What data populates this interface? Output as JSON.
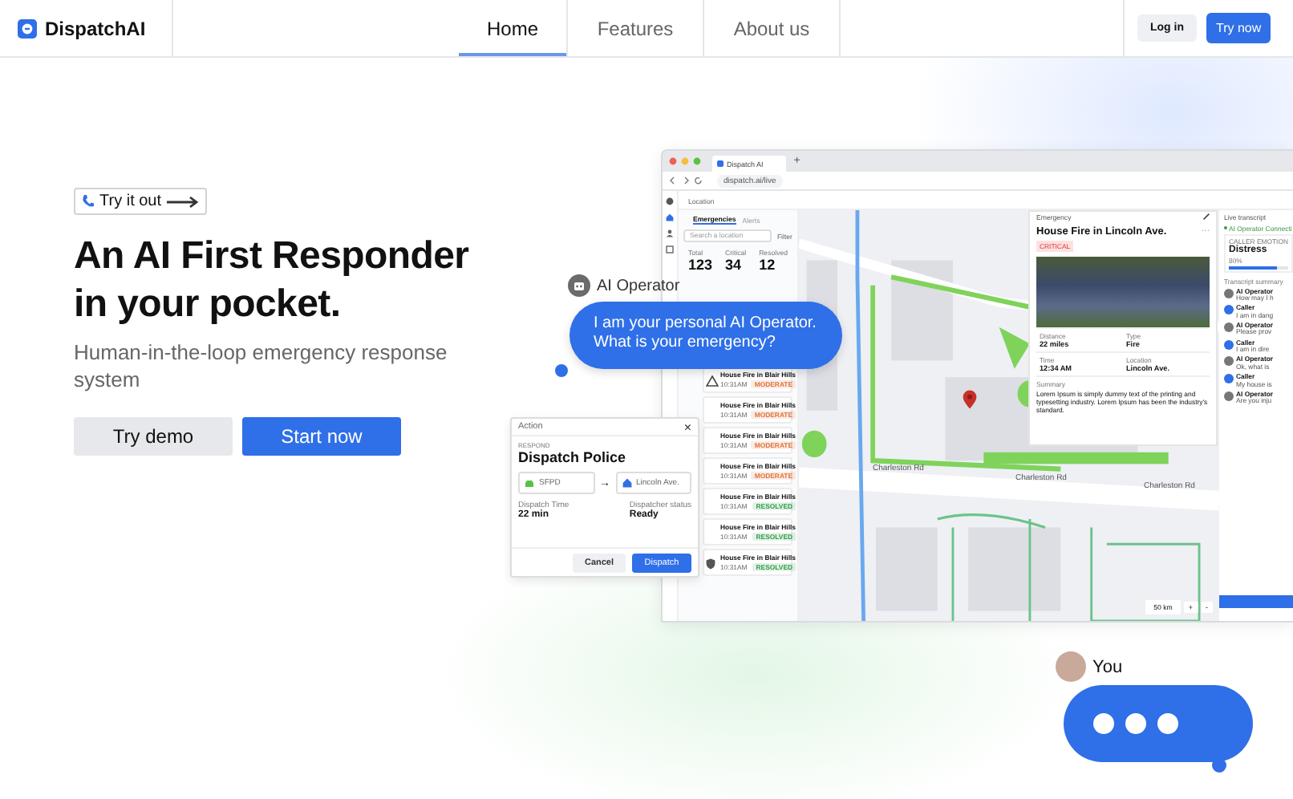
{
  "nav": {
    "logo": "DispatchAI",
    "links": [
      {
        "label": "Home",
        "selected": true
      },
      {
        "label": "Features",
        "selected": false
      },
      {
        "label": "About us",
        "selected": false
      }
    ],
    "login": "Log in",
    "try_now": "Try now"
  },
  "hero": {
    "pill": "Try it out",
    "title": "An AI First Responder in your pocket.",
    "subtitle": "Human-in-the-loop emergency response system",
    "buttons": [
      {
        "label": "Try demo",
        "kind": "secondary"
      },
      {
        "label": "Start now",
        "kind": "primary"
      }
    ]
  },
  "app": {
    "tab": "Dispatch AI",
    "new_tab": "+",
    "url": "dispatch.ai/live",
    "location_label": "Location",
    "list_tabs": [
      {
        "label": "Emergencies",
        "selected": true
      },
      {
        "label": "Alerts",
        "selected": false
      }
    ],
    "search_placeholder": "Search a location",
    "filter": "Filter",
    "stats": [
      {
        "label": "Total",
        "value": "123"
      },
      {
        "label": "Critical",
        "value": "34"
      },
      {
        "label": "Resolved",
        "value": "12"
      }
    ],
    "incidents": [
      {
        "title": "House Fire in Blair Hills",
        "time": "10:31AM",
        "status": "MODERATE",
        "color": "#e0733a",
        "kind": "warning"
      },
      {
        "title": "House Fire in Blair Hills",
        "time": "10:31AM",
        "status": "MODERATE",
        "color": "#e0733a",
        "kind": "none"
      },
      {
        "title": "House Fire in Blair Hills",
        "time": "10:31AM",
        "status": "MODERATE",
        "color": "#e0733a",
        "kind": "none"
      },
      {
        "title": "House Fire in Blair Hills",
        "time": "10:31AM",
        "status": "MODERATE",
        "color": "#e0733a",
        "kind": "none"
      },
      {
        "title": "House Fire in Blair Hills",
        "time": "10:31AM",
        "status": "RESOLVED",
        "color": "#2e9d48",
        "kind": "none"
      },
      {
        "title": "House Fire in Blair Hills",
        "time": "10:31AM",
        "status": "RESOLVED",
        "color": "#2e9d48",
        "kind": "none"
      },
      {
        "title": "House Fire in Blair Hills",
        "time": "10:31AM",
        "status": "RESOLVED",
        "color": "#2e9d48",
        "kind": "shield"
      }
    ],
    "map": {
      "labels": [
        "Charleston Rd",
        "Charleston Rd",
        "Charleston Rd"
      ],
      "scale": "50 km",
      "zoom_in": "+",
      "zoom_out": "-"
    },
    "emergency": {
      "header": "Emergency",
      "title": "House Fire in Lincoln Ave.",
      "badge": "CRITICAL",
      "more": "···",
      "facts": [
        {
          "label": "Distance",
          "value": "22 miles"
        },
        {
          "label": "Type",
          "value": "Fire"
        },
        {
          "label": "Time",
          "value": "12:34 AM"
        },
        {
          "label": "Location",
          "value": "Lincoln Ave."
        }
      ],
      "summary_label": "Summary",
      "summary": "Lorem Ipsum is simply dummy text of the printing and typesetting industry. Lorem Ipsum has been the industry's standard."
    },
    "transcript": {
      "header": "Live transcript",
      "status": "AI Operator Connecti",
      "emotion_label": "CALLER EMOTION",
      "emotion": "Distress",
      "percent": "80%",
      "level": 0.8,
      "summary_label": "Transcript summary",
      "messages": [
        {
          "speaker": "AI Operator",
          "text": "How may I h",
          "kind": "ai"
        },
        {
          "speaker": "Caller",
          "text": "I am in dang",
          "kind": "caller"
        },
        {
          "speaker": "AI Operator",
          "text": "Please prov",
          "kind": "ai"
        },
        {
          "speaker": "Caller",
          "text": "I am in dire",
          "kind": "caller"
        },
        {
          "speaker": "AI Operator",
          "text": "Ok, what is",
          "kind": "ai"
        },
        {
          "speaker": "Caller",
          "text": "My house is",
          "kind": "caller"
        },
        {
          "speaker": "AI Operator",
          "text": "Are you inju",
          "kind": "ai"
        }
      ]
    }
  },
  "operator": {
    "name": "AI Operator",
    "message": "I am your personal AI Operator. What is your emergency?"
  },
  "action": {
    "header": "Action",
    "close": "×",
    "eyebrow": "RESPOND",
    "title": "Dispatch Police",
    "from": "SFPD",
    "arrow": "→",
    "to": "Lincoln Ave.",
    "fields": [
      {
        "label": "Dispatch Time",
        "value": "22 min"
      },
      {
        "label": "Dispatcher status",
        "value": "Ready"
      }
    ],
    "cancel": "Cancel",
    "confirm": "Dispatch"
  },
  "you": {
    "name": "You"
  }
}
